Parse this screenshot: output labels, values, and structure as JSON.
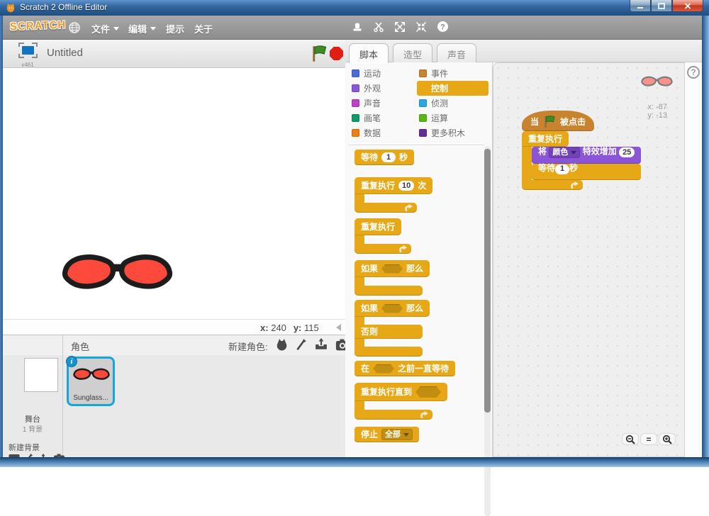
{
  "titlebar": {
    "title": "Scratch 2 Offline Editor"
  },
  "menubar": {
    "logo": "SCRATCH",
    "file": "文件",
    "edit": "编辑",
    "tips": "提示",
    "about": "关于"
  },
  "stage_header": {
    "title": "Untitled",
    "version": "v461"
  },
  "stage_status": {
    "x_label": "x:",
    "x_value": "240",
    "y_label": "y:",
    "y_value": "115"
  },
  "sprites_panel": {
    "title": "角色",
    "new_sprite_label": "新建角色:",
    "stage_name": "舞台",
    "stage_count": "1 背景",
    "new_backdrop_label": "新建背景",
    "sprite_name": "Sunglass..."
  },
  "tabs": {
    "scripts": "脚本",
    "costumes": "造型",
    "sounds": "声音"
  },
  "categories": [
    {
      "label": "运动",
      "color": "#4a6cd4"
    },
    {
      "label": "外观",
      "color": "#8a55d7"
    },
    {
      "label": "声音",
      "color": "#bb42c3"
    },
    {
      "label": "画笔",
      "color": "#0e9a6c"
    },
    {
      "label": "数据",
      "color": "#ee7d16"
    },
    {
      "label": "事件",
      "color": "#c8832f"
    },
    {
      "label": "控制",
      "color": "#e6a817",
      "selected": true
    },
    {
      "label": "侦测",
      "color": "#2ca5e2"
    },
    {
      "label": "运算",
      "color": "#5cb712"
    },
    {
      "label": "更多积木",
      "color": "#632d99"
    }
  ],
  "palette": {
    "wait_t1": "等待",
    "wait_val": "1",
    "wait_t2": "秒",
    "repeat_t1": "重复执行",
    "repeat_val": "10",
    "repeat_t2": "次",
    "forever": "重复执行",
    "if_t1": "如果",
    "if_t2": "那么",
    "else_label": "否则",
    "waituntil_t1": "在",
    "waituntil_t2": "之前一直等待",
    "repeatuntil": "重复执行直到",
    "stop": "停止",
    "stop_opt": "全部"
  },
  "script": {
    "x_label": "x:",
    "x_value": "-87",
    "y_label": "y:",
    "y_value": "-13",
    "when_t1": "当",
    "when_t2": "被点击",
    "forever": "重复执行",
    "effect_t1": "将",
    "effect_opt": "颜色",
    "effect_t2": "特效增加",
    "effect_val": "25",
    "wait_t1": "等待",
    "wait_val": "1",
    "wait_t2": "秒"
  },
  "colors": {
    "control_gold": "#e6a817",
    "events_brown": "#c8832f",
    "looks_purple": "#8a55d7",
    "selection_blue": "#18a5d8",
    "sprite_red": "#fd4a3c",
    "stop_red": "#e01f12"
  }
}
